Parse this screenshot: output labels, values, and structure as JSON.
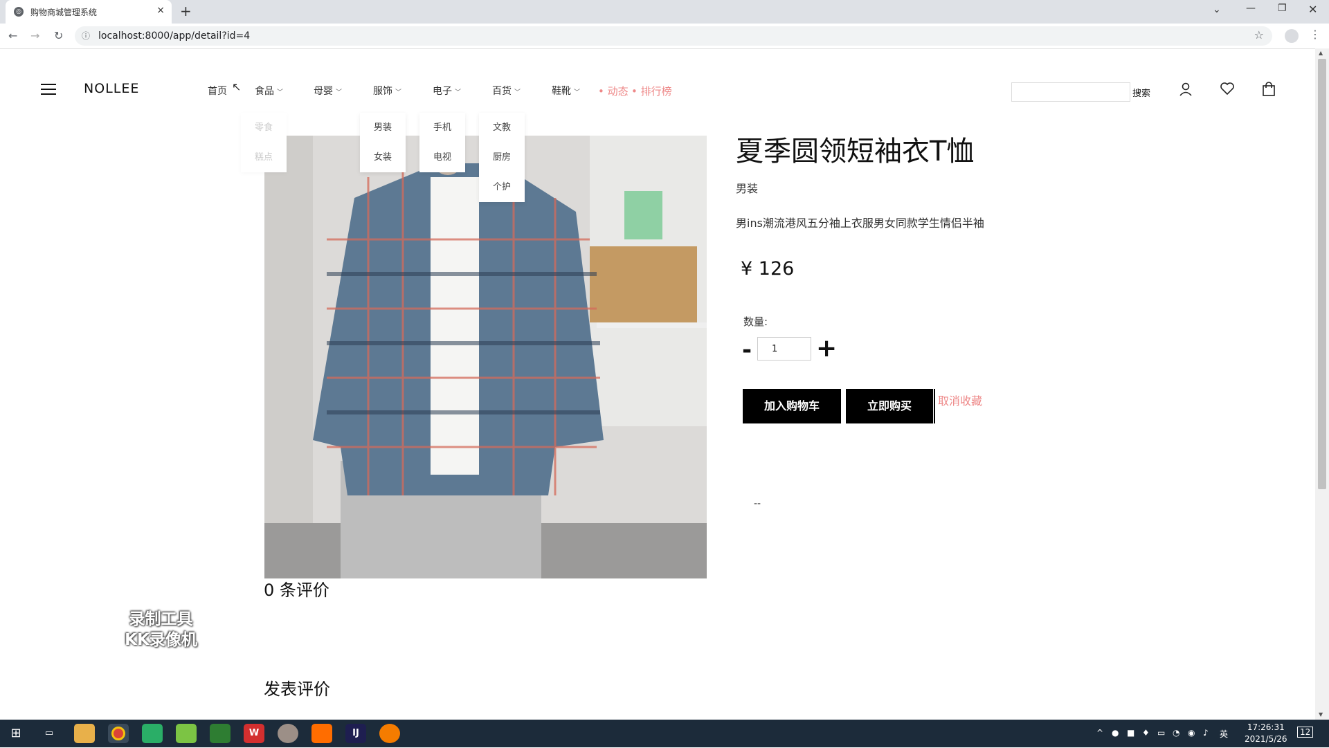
{
  "browser": {
    "tab_title": "购物商城管理系统",
    "url": "localhost:8000/app/detail?id=4",
    "new_tab": "+",
    "close_tab": "×"
  },
  "header": {
    "logo": "NOLLEE",
    "menu": [
      {
        "label": "首页"
      },
      {
        "label": "食品"
      },
      {
        "label": "母婴"
      },
      {
        "label": "服饰"
      },
      {
        "label": "电子"
      },
      {
        "label": "百货"
      },
      {
        "label": "鞋靴"
      }
    ],
    "dynamic": "• 动态",
    "ranking": "• 排行榜",
    "search_button": "搜索"
  },
  "dropdowns": {
    "food": [
      "零食",
      "糕点"
    ],
    "clothing": [
      "男装",
      "女装"
    ],
    "electronics": [
      "手机",
      "电视"
    ],
    "goods": [
      "文教",
      "厨房",
      "个护"
    ]
  },
  "product": {
    "title": "夏季圆领短袖衣T恤",
    "category": "男装",
    "description": "男ins潮流港风五分袖上衣服男女同款学生情侣半袖",
    "price": "¥ 126",
    "quantity_label": "数量:",
    "quantity_value": "1",
    "minus": "-",
    "plus": "+",
    "add_to_cart": "加入购物车",
    "buy_now": "立即购买",
    "cancel_favorite": "取消收藏",
    "extra_text": "--"
  },
  "reviews": {
    "count_text": "0 条评价",
    "post_title": "发表评价"
  },
  "watermark": {
    "line1": "录制工具",
    "line2": "KK录像机"
  },
  "taskbar": {
    "time": "17:26:31",
    "date": "2021/5/26",
    "ime": "英",
    "notifications": "12"
  },
  "colors": {
    "accent_red": "#e88888",
    "button_black": "#000000",
    "taskbar": "#1c2b3a"
  }
}
